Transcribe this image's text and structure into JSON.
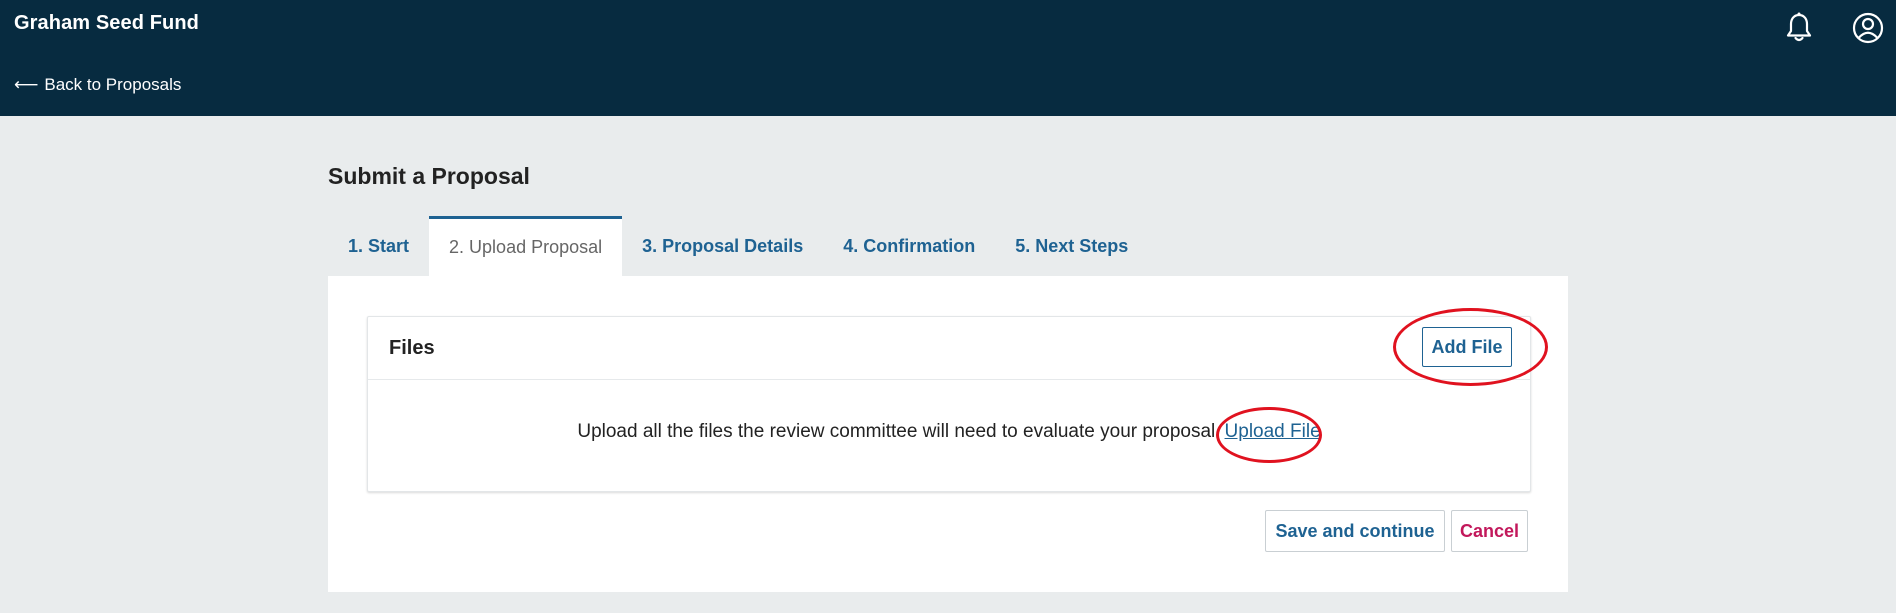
{
  "header": {
    "app_title": "Graham Seed Fund",
    "back_label": "Back to Proposals",
    "back_arrow": "⟵"
  },
  "icons": {
    "notifications": "bell-icon",
    "account": "user-circle-icon"
  },
  "page": {
    "title": "Submit a Proposal"
  },
  "tabs": [
    {
      "label": "1. Start",
      "active": false
    },
    {
      "label": "2. Upload Proposal",
      "active": true
    },
    {
      "label": "3. Proposal Details",
      "active": false
    },
    {
      "label": "4. Confirmation",
      "active": false
    },
    {
      "label": "5. Next Steps",
      "active": false
    }
  ],
  "files": {
    "title": "Files",
    "add_label": "Add File",
    "message": "Upload all the files the review committee will need to evaluate your proposal.",
    "upload_link": "Upload File"
  },
  "actions": {
    "save_label": "Save and continue",
    "cancel_label": "Cancel"
  },
  "colors": {
    "header_bg": "#072b40",
    "page_bg": "#e9eced",
    "link_blue": "#1e6292",
    "cancel_red": "#c2185b",
    "annotation_red": "#e0121f"
  }
}
